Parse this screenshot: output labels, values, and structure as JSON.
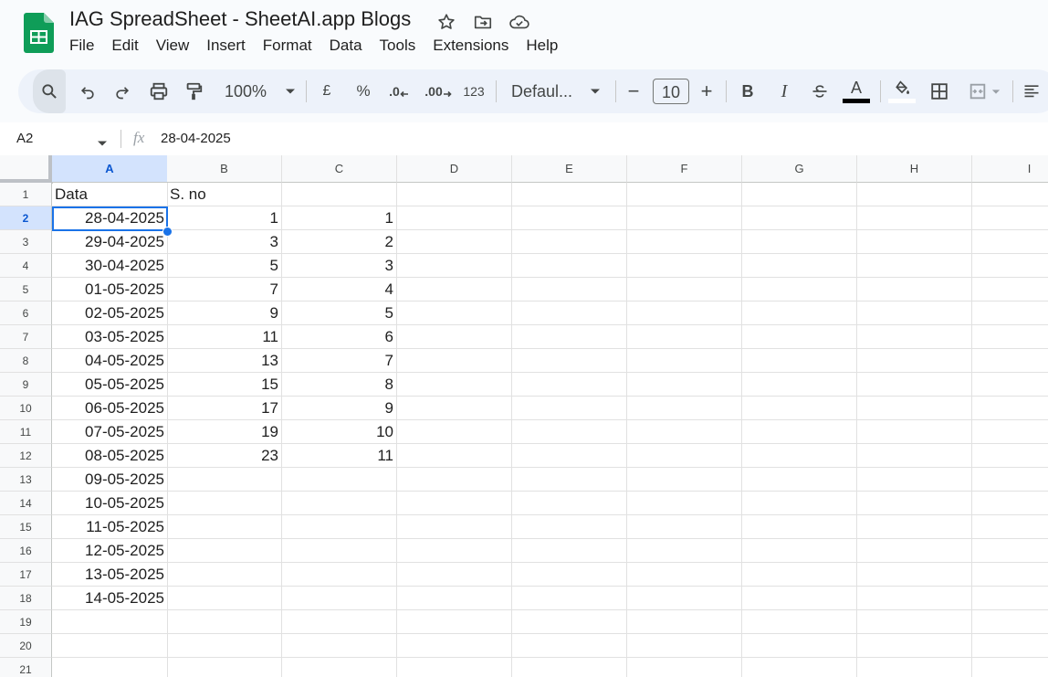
{
  "app": {
    "title": "IAG SpreadSheet - SheetAI.app Blogs",
    "accent": "#0f9d58"
  },
  "menu": [
    "File",
    "Edit",
    "View",
    "Insert",
    "Format",
    "Data",
    "Tools",
    "Extensions",
    "Help"
  ],
  "toolbar": {
    "zoom": "100%",
    "currency": "£",
    "percent": "%",
    "dec_decrease": ".0",
    "dec_increase": ".00",
    "number_format": "123",
    "font": "Defaul...",
    "font_size": "10",
    "minus": "−",
    "plus": "+",
    "bold": "B",
    "italic": "I",
    "text_color_letter": "A",
    "text_color": "#000000"
  },
  "formula_bar": {
    "name_box": "A2",
    "fx": "fx",
    "value": "28-04-2025"
  },
  "columns": [
    "A",
    "B",
    "C",
    "D",
    "E",
    "F",
    "G",
    "H",
    "I"
  ],
  "selected": {
    "col": "A",
    "row": "2"
  },
  "rows": [
    {
      "n": "1",
      "a": "Data",
      "b": "S. no",
      "c": ""
    },
    {
      "n": "2",
      "a": "28-04-2025",
      "b": "1",
      "c": "1"
    },
    {
      "n": "3",
      "a": "29-04-2025",
      "b": "3",
      "c": "2"
    },
    {
      "n": "4",
      "a": "30-04-2025",
      "b": "5",
      "c": "3"
    },
    {
      "n": "5",
      "a": "01-05-2025",
      "b": "7",
      "c": "4"
    },
    {
      "n": "6",
      "a": "02-05-2025",
      "b": "9",
      "c": "5"
    },
    {
      "n": "7",
      "a": "03-05-2025",
      "b": "11",
      "c": "6"
    },
    {
      "n": "8",
      "a": "04-05-2025",
      "b": "13",
      "c": "7"
    },
    {
      "n": "9",
      "a": "05-05-2025",
      "b": "15",
      "c": "8"
    },
    {
      "n": "10",
      "a": "06-05-2025",
      "b": "17",
      "c": "9"
    },
    {
      "n": "11",
      "a": "07-05-2025",
      "b": "19",
      "c": "10"
    },
    {
      "n": "12",
      "a": "08-05-2025",
      "b": "23",
      "c": "11"
    },
    {
      "n": "13",
      "a": "09-05-2025",
      "b": "",
      "c": ""
    },
    {
      "n": "14",
      "a": "10-05-2025",
      "b": "",
      "c": ""
    },
    {
      "n": "15",
      "a": "11-05-2025",
      "b": "",
      "c": ""
    },
    {
      "n": "16",
      "a": "12-05-2025",
      "b": "",
      "c": ""
    },
    {
      "n": "17",
      "a": "13-05-2025",
      "b": "",
      "c": ""
    },
    {
      "n": "18",
      "a": "14-05-2025",
      "b": "",
      "c": ""
    },
    {
      "n": "19",
      "a": "",
      "b": "",
      "c": ""
    },
    {
      "n": "20",
      "a": "",
      "b": "",
      "c": ""
    },
    {
      "n": "21",
      "a": "",
      "b": "",
      "c": ""
    }
  ]
}
